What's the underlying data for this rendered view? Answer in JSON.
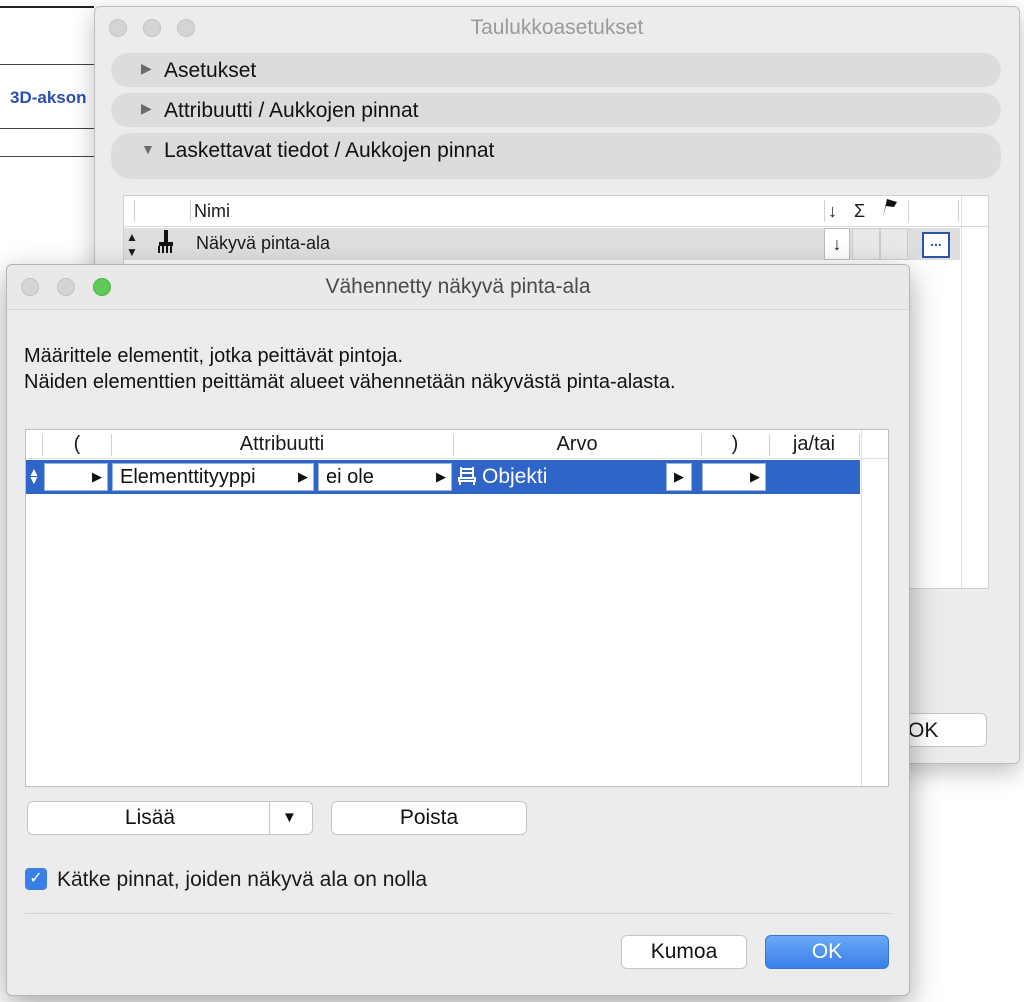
{
  "background_app": {
    "tab_label": "3D-akson"
  },
  "back_window": {
    "title": "Taulukkoasetukset",
    "sections": [
      {
        "label": "Asetukset",
        "expanded": false
      },
      {
        "label": "Attribuutti /  Aukkojen pinnat",
        "expanded": false
      },
      {
        "label": "Laskettavat tiedot /  Aukkojen pinnat",
        "expanded": true
      }
    ],
    "table": {
      "header_name": "Nimi",
      "header_icons": [
        "↓",
        "Σ",
        "flag-icon"
      ],
      "rows": [
        {
          "name": "Näkyvä pinta-ala",
          "sort_value": "↓",
          "more": "..."
        }
      ]
    },
    "ok_label": "OK"
  },
  "dialog": {
    "title": "Vähennetty näkyvä pinta-ala",
    "description_line1": "Määrittele elementit, jotka peittävät pintoja.",
    "description_line2": "Näiden elementtien peittämät alueet vähennetään näkyvästä pinta-alasta.",
    "columns": [
      "(",
      "Attribuutti",
      "Arvo",
      ")",
      "ja/tai"
    ],
    "rows": [
      {
        "open_paren": "",
        "attribute": "Elementtityyppi",
        "operator": "ei ole",
        "value": "Objekti",
        "close_paren": "",
        "and_or": ""
      }
    ],
    "add_label": "Lisää",
    "remove_label": "Poista",
    "hide_zero_label": "Kätke pinnat, joiden näkyvä ala on nolla",
    "hide_zero_checked": true,
    "cancel_label": "Kumoa",
    "ok_label": "OK"
  },
  "colors": {
    "selection": "#2f65c8",
    "default_button": "#3a7fe8"
  }
}
